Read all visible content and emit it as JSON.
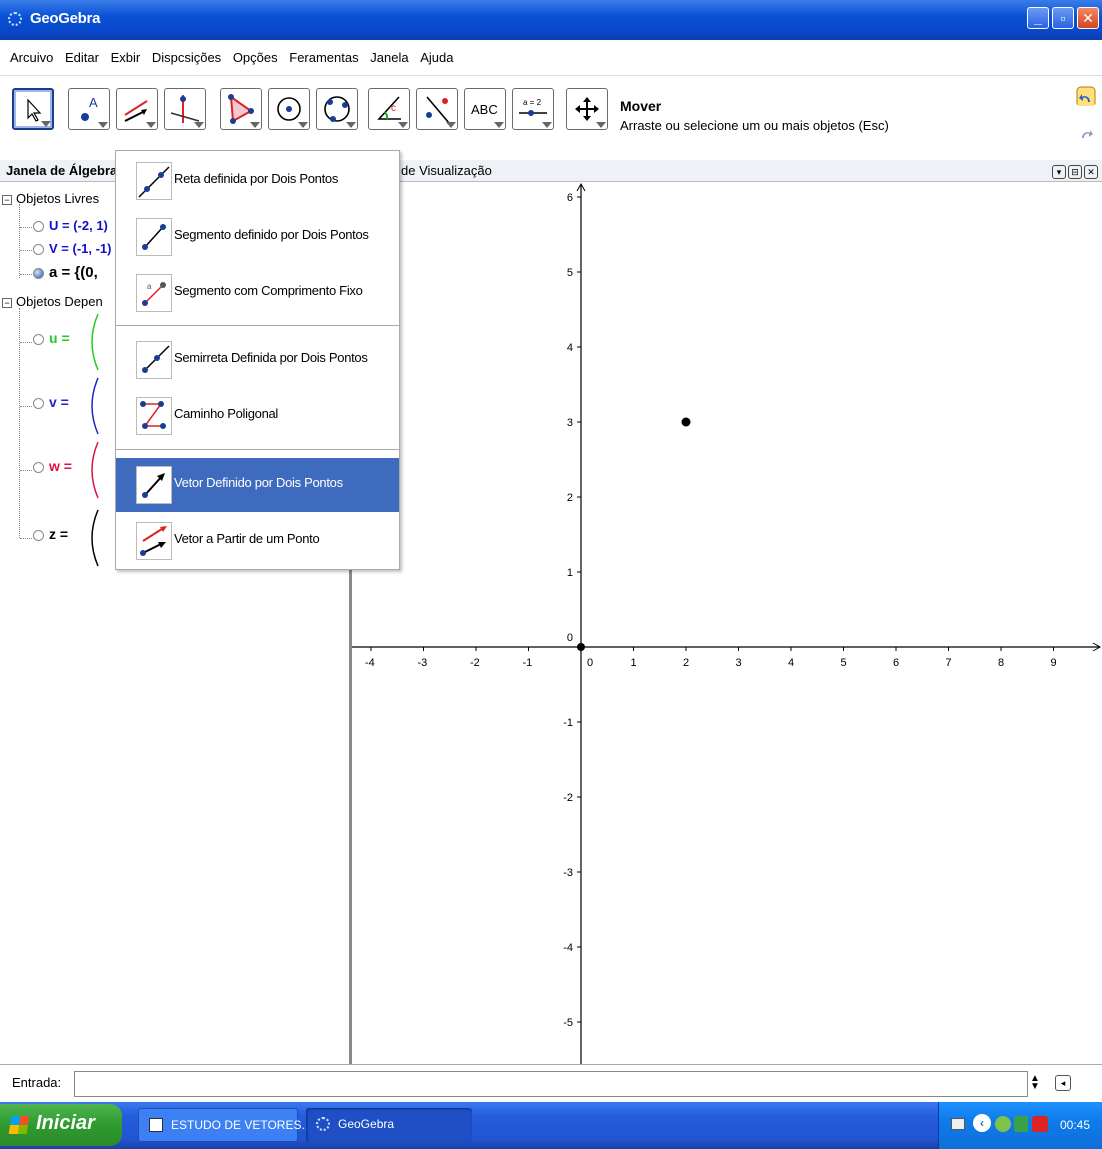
{
  "window": {
    "title": "GeoGebra",
    "buttons": [
      "_",
      "▫",
      "X"
    ]
  },
  "menu": [
    "Arcuivo",
    "Editar",
    "Exbir",
    "Dispcsições",
    "Opções",
    "Feramentas",
    "Janela",
    "Ajuda"
  ],
  "toolbar": {
    "active_tool_name": "Mover",
    "active_tool_desc": "Arraste ou selecione um ou mais objetos (Esc)",
    "text_tool_label": "ABC",
    "slider_tool_label": "a = 2"
  },
  "algebra": {
    "header": "Janela de Álgebra",
    "free_group": "Objetos Livres",
    "dep_group": "Objetos Depen",
    "free_items": [
      {
        "name": "U",
        "text": "U = (-2, 1)",
        "color": "#1010cc"
      },
      {
        "name": "V",
        "text": "V = (-1, -1)",
        "color": "#1010cc"
      },
      {
        "name": "a",
        "text": "a = {(0,",
        "color": "#000000"
      }
    ],
    "dep_items": [
      {
        "name": "u",
        "text": "u =",
        "color": "#22cc22"
      },
      {
        "name": "v",
        "text": "v =",
        "color": "#2222cc"
      },
      {
        "name": "w",
        "text": "w =",
        "color": "#dd1144"
      },
      {
        "name": "z",
        "text": "z =",
        "color": "#000000"
      }
    ]
  },
  "graphics": {
    "header": "de Visualização",
    "x_ticks": [
      "-4",
      "-3",
      "-2",
      "-1",
      "0",
      "1",
      "2",
      "3",
      "4",
      "5",
      "6",
      "7",
      "8",
      "9"
    ],
    "y_ticks": [
      "6",
      "5",
      "4",
      "3",
      "2",
      "1",
      "0",
      "-1",
      "-2",
      "-3",
      "-4",
      "-5"
    ],
    "point": {
      "x": 2,
      "y": 3
    }
  },
  "dropdown": {
    "items": [
      {
        "label": "Reta definida por Dois Pontos"
      },
      {
        "label": "Segmento definido por Dois Pontos"
      },
      {
        "label": "Segmento com Comprimento Fixo"
      },
      {
        "label": "Semirreta Definida por Dois Pontos"
      },
      {
        "label": "Caminho Poligonal"
      },
      {
        "label": "Vetor Definido por Dois Pontos",
        "selected": true
      },
      {
        "label": "Vetor a Partir de um Ponto"
      }
    ]
  },
  "input_bar": {
    "label": "Entrada:",
    "value": ""
  },
  "taskbar": {
    "start_label": "Iniciar",
    "tasks": [
      "ESTUDO DE VETORES...",
      "GeoGebra"
    ],
    "clock": "00:45"
  }
}
